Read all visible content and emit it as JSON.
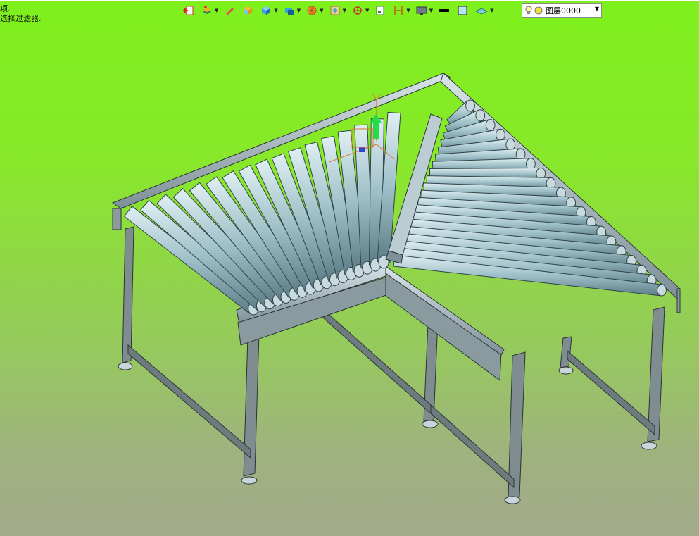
{
  "prompt": {
    "line1": "项.",
    "line2": "选择过滤器."
  },
  "toolbar": {
    "icons": [
      "exit-icon",
      "layer-manager-icon",
      "pencil-icon",
      "cube-icon",
      "box-icon",
      "solid-icon",
      "wheel-icon",
      "view-icon",
      "orbit-icon",
      "doc-icon",
      "dimension-icon",
      "monitor-icon",
      "line-color-icon",
      "fill-color-icon",
      "surface-icon"
    ]
  },
  "layer": {
    "name": "图层0000",
    "icons": [
      "lightbulb-icon",
      "sun-icon"
    ]
  },
  "colors": {
    "background_top": "#7ef01c",
    "background_bottom": "#a3aa8b",
    "roller": "#9fc0c8",
    "frame": "#a9b8bd"
  }
}
